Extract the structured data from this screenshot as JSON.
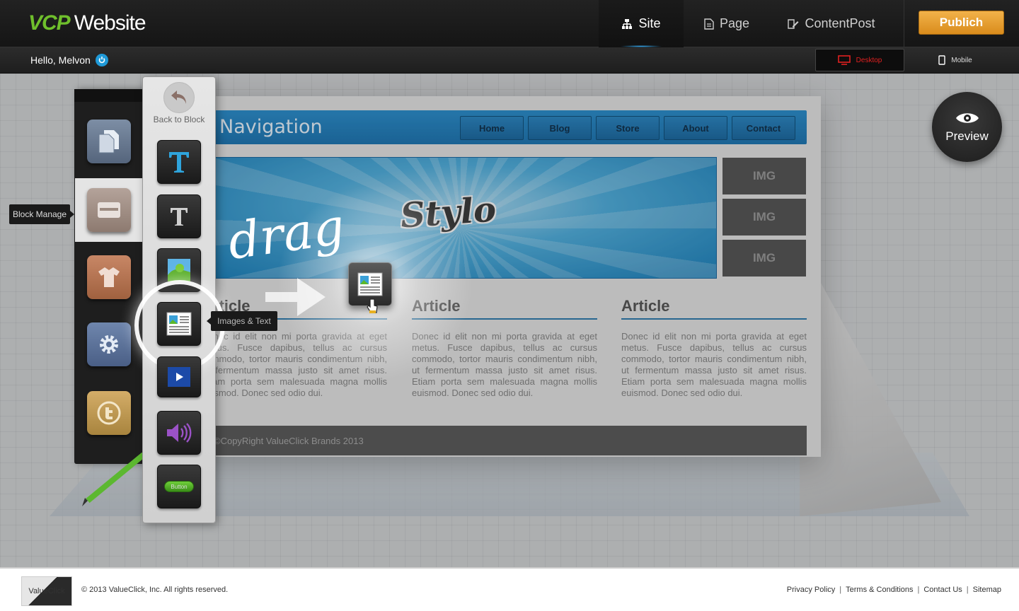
{
  "header": {
    "logo_vcp": "VCP",
    "logo_website": "Website",
    "tabs": [
      {
        "label": "Site",
        "icon": "sitemap-icon",
        "active": true
      },
      {
        "label": "Page",
        "icon": "page-icon",
        "active": false
      },
      {
        "label": "ContentPost",
        "icon": "edit-icon",
        "active": false
      }
    ],
    "publish_label": "Publich",
    "accent_color": "#e39a2d"
  },
  "subbar": {
    "greeting": "Hello, Melvon",
    "desktop_label": "Desktop",
    "mobile_label": "Mobile"
  },
  "left_panel": {
    "tooltip_block_manage": "Block Manage",
    "back_label": "Back to Block",
    "tooltip_images_text": "Images & Text",
    "main_buttons": [
      "pages-icon",
      "block-icon",
      "shirt-icon",
      "gear-icon",
      "twitter-icon"
    ],
    "sub_buttons": [
      "text-heading-icon",
      "text-icon",
      "image-icon",
      "image-text-icon",
      "video-icon",
      "audio-icon",
      "button-icon"
    ],
    "button_widget_label": "Button"
  },
  "canvas": {
    "nav_title": "Navigation",
    "nav_links": [
      "Home",
      "Blog",
      "Store",
      "About",
      "Contact"
    ],
    "hero_text": "Stylo",
    "img_labels": [
      "IMG",
      "IMG",
      "IMG"
    ],
    "articles": [
      {
        "title": "Article",
        "body": "Donec id elit non mi porta gravida at eget metus. Fusce dapibus, tellus ac cursus commodo, tortor mauris condimentum nibh, ut fermentum massa justo sit amet risus. Etiam porta sem malesuada magna mollis euismod. Donec sed odio dui."
      },
      {
        "title": "Article",
        "body": "Donec id elit non mi porta gravida at eget metus. Fusce dapibus, tellus ac cursus commodo, tortor mauris condimentum nibh, ut fermentum massa justo sit amet risus. Etiam porta sem malesuada magna mollis euismod. Donec sed odio dui."
      },
      {
        "title": "Article",
        "body": "Donec id elit non mi porta gravida at eget metus. Fusce dapibus, tellus ac cursus commodo, tortor mauris condimentum nibh, ut fermentum massa justo sit amet risus. Etiam porta sem malesuada magna mollis euismod. Donec sed odio dui."
      }
    ],
    "site_footer": "©CopyRight ValueClick Brands 2013",
    "drag_word": "drag"
  },
  "preview_label": "Preview",
  "footer": {
    "logo_text": "ValueClick",
    "copyright": "© 2013 ValueClick, Inc. All rights reserved.",
    "links": [
      "Privacy Policy",
      "Terms & Conditions",
      "Contact Us",
      "Sitemap"
    ]
  }
}
